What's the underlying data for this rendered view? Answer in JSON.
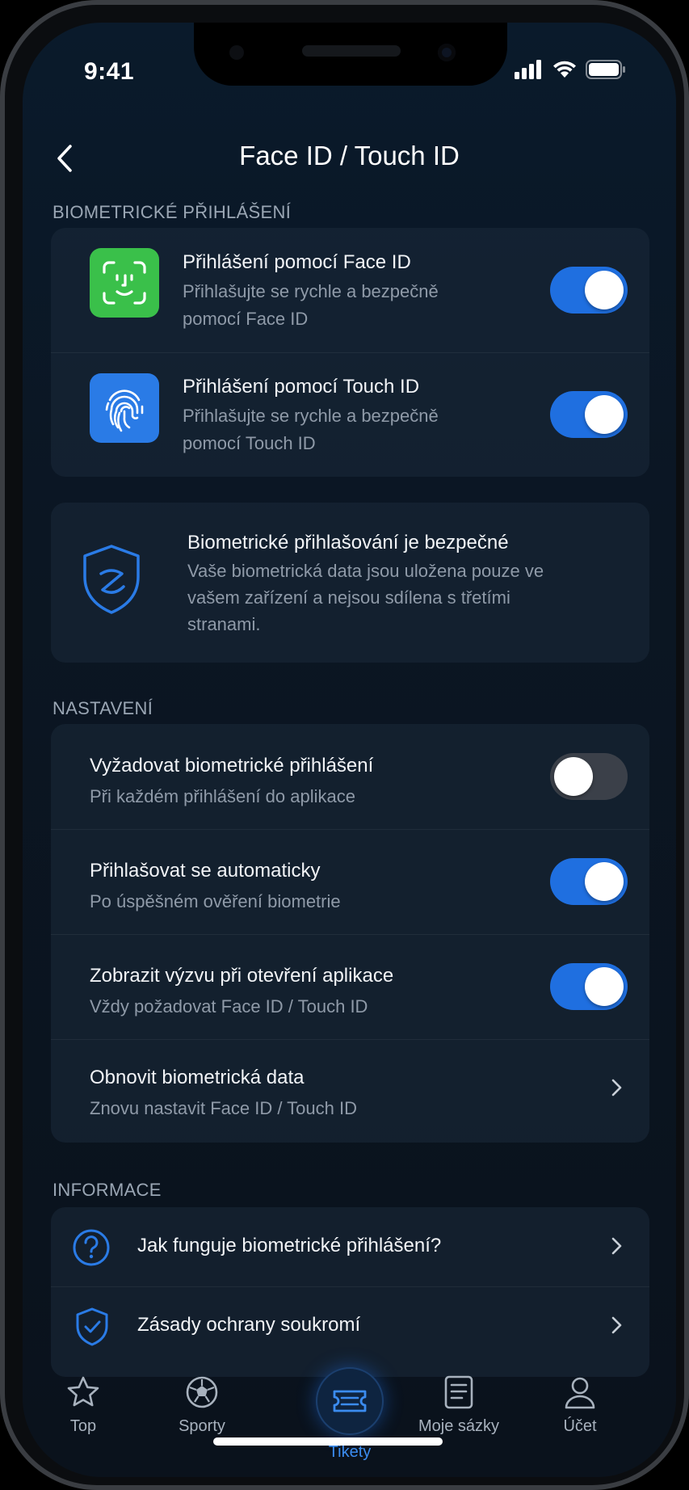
{
  "status": {
    "time": "9:41"
  },
  "nav": {
    "title": "Face ID / Touch ID"
  },
  "sections": {
    "biometric": "BIOMETRICKÉ PŘIHLÁŠENÍ",
    "settings": "NASTAVENÍ",
    "info": "INFORMACE"
  },
  "biometric": {
    "face": {
      "title": "Přihlášení pomocí Face ID",
      "sub1": "Přihlašujte se rychle a bezpečně",
      "sub2": "pomocí Face ID",
      "enabled": true
    },
    "touch": {
      "title": "Přihlášení pomocí Touch ID",
      "sub1": "Přihlašujte se rychle a bezpečně",
      "sub2": "pomocí Touch ID",
      "enabled": true
    }
  },
  "security_note": {
    "title": "Biometrické přihlašování je bezpečné",
    "line1": "Vaše biometrická data jsou uložena pouze ve",
    "line2": "vašem zařízení a nejsou sdílena s třetími",
    "line3": "stranami."
  },
  "settings": [
    {
      "title": "Vyžadovat biometrické přihlášení",
      "sub": "Při každém přihlášení do aplikace",
      "enabled": false
    },
    {
      "title": "Přihlašovat se automaticky",
      "sub": "Po úspěšném ověření biometrie",
      "enabled": true
    },
    {
      "title": "Zobrazit výzvu při otevření aplikace",
      "sub": "Vždy požadovat Face ID / Touch ID",
      "enabled": true
    },
    {
      "title": "Obnovit biometrická data",
      "sub": "Znovu nastavit Face ID / Touch ID"
    }
  ],
  "info": [
    {
      "title": "Jak funguje biometrické přihlášení?",
      "icon": "question-circle-icon"
    },
    {
      "title": "Zásady ochrany soukromí",
      "icon": "shield-check-icon"
    }
  ],
  "tabs": [
    {
      "label": "Top",
      "icon": "star-icon"
    },
    {
      "label": "Sporty",
      "icon": "soccer-ball-icon"
    },
    {
      "label": "Tikety",
      "icon": "ticket-icon",
      "active": true
    },
    {
      "label": "Moje sázky",
      "icon": "list-icon"
    },
    {
      "label": "Účet",
      "icon": "user-icon"
    }
  ],
  "colors": {
    "accent": "#1f6fe0",
    "face_icon_bg": "#3ac04a",
    "touch_icon_bg": "#2a7be6",
    "active_tab": "#3b8cf0"
  }
}
